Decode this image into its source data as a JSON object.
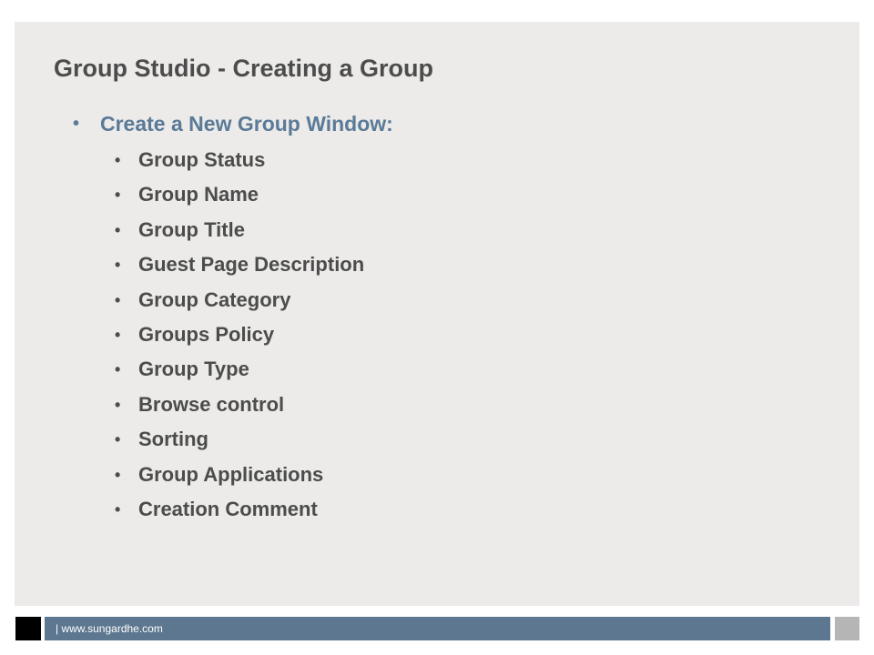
{
  "slide": {
    "title": "Group Studio - Creating a Group",
    "level1_bullet": {
      "label": "Create a New Group Window:"
    },
    "sub_items": [
      "Group Status",
      "Group Name",
      "Group Title",
      "Guest Page Description",
      "Group Category",
      "Groups Policy",
      "Group Type",
      "Browse control",
      "Sorting",
      "Group Applications",
      "Creation Comment"
    ],
    "bullet_char": "•"
  },
  "footer": {
    "text": "| www.sungardhe.com"
  },
  "colors": {
    "background": "#ecebe9",
    "title": "#4c4c4c",
    "accent": "#5a7a97",
    "footer_bar": "#5c778f"
  }
}
